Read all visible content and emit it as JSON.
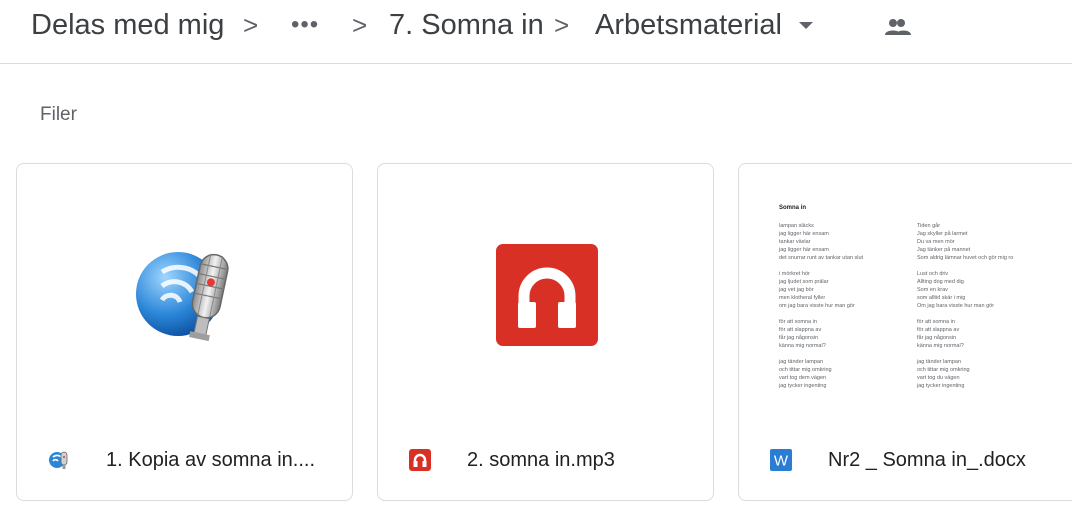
{
  "breadcrumb": {
    "root": "Delas med mig",
    "separator": ">",
    "ellipsis": "•••",
    "folder": "7. Somna in",
    "current": "Arbetsmaterial"
  },
  "section_title": "Filer",
  "files": [
    {
      "name": "1. Kopia av somna in....",
      "type_icon": "audio-recorder-icon"
    },
    {
      "name": "2. somna in.mp3",
      "type_icon": "headphones-icon"
    },
    {
      "name": "Nr2 _ Somna in_.docx",
      "type_icon": "word-doc-icon"
    }
  ],
  "doc_preview": {
    "title": "Somna in",
    "left_column": [
      [
        "lampan släcks",
        "jag ligger här ensam",
        "tankar växlar",
        "jag ligger här ensam",
        "det snurrar runt av tankar utan slut"
      ],
      [
        "i mörkret hör",
        "jag ljudet som prälar",
        "jag vet jag bör",
        "men klotheral fyller",
        "om jag bara visste hur man gör"
      ],
      [
        "för att somna in",
        "för att slappna av",
        "får jag någonsin",
        "känna mig normal?"
      ],
      [
        "jag tänder lampan",
        "och tittar mig omkring",
        "vart tog dem vägen",
        "jag tycker ingenting"
      ]
    ],
    "right_column": [
      [
        "Tiden går",
        "Jag skyller på larmet",
        "Du va men mör",
        "Jag tänker på mannet",
        "Som aldrig lämnar huvet och gör mig ro"
      ],
      [
        "Lust och driv",
        "Allting dog med dig",
        "Som en krav",
        "som alltid skär i mig",
        "Om jag bara visste hur man gör"
      ],
      [
        "för att somna in",
        "för att slappna av",
        "får jag någonsin",
        "känna mig normal?"
      ],
      [
        "jag tänder lampan",
        "och tittar mig omkring",
        "vart tog du vägen",
        "jag tycker ingenting"
      ]
    ]
  },
  "colors": {
    "mp3_red": "#d93025",
    "word_blue": "#2b7cd3",
    "divider": "#dadce0"
  }
}
